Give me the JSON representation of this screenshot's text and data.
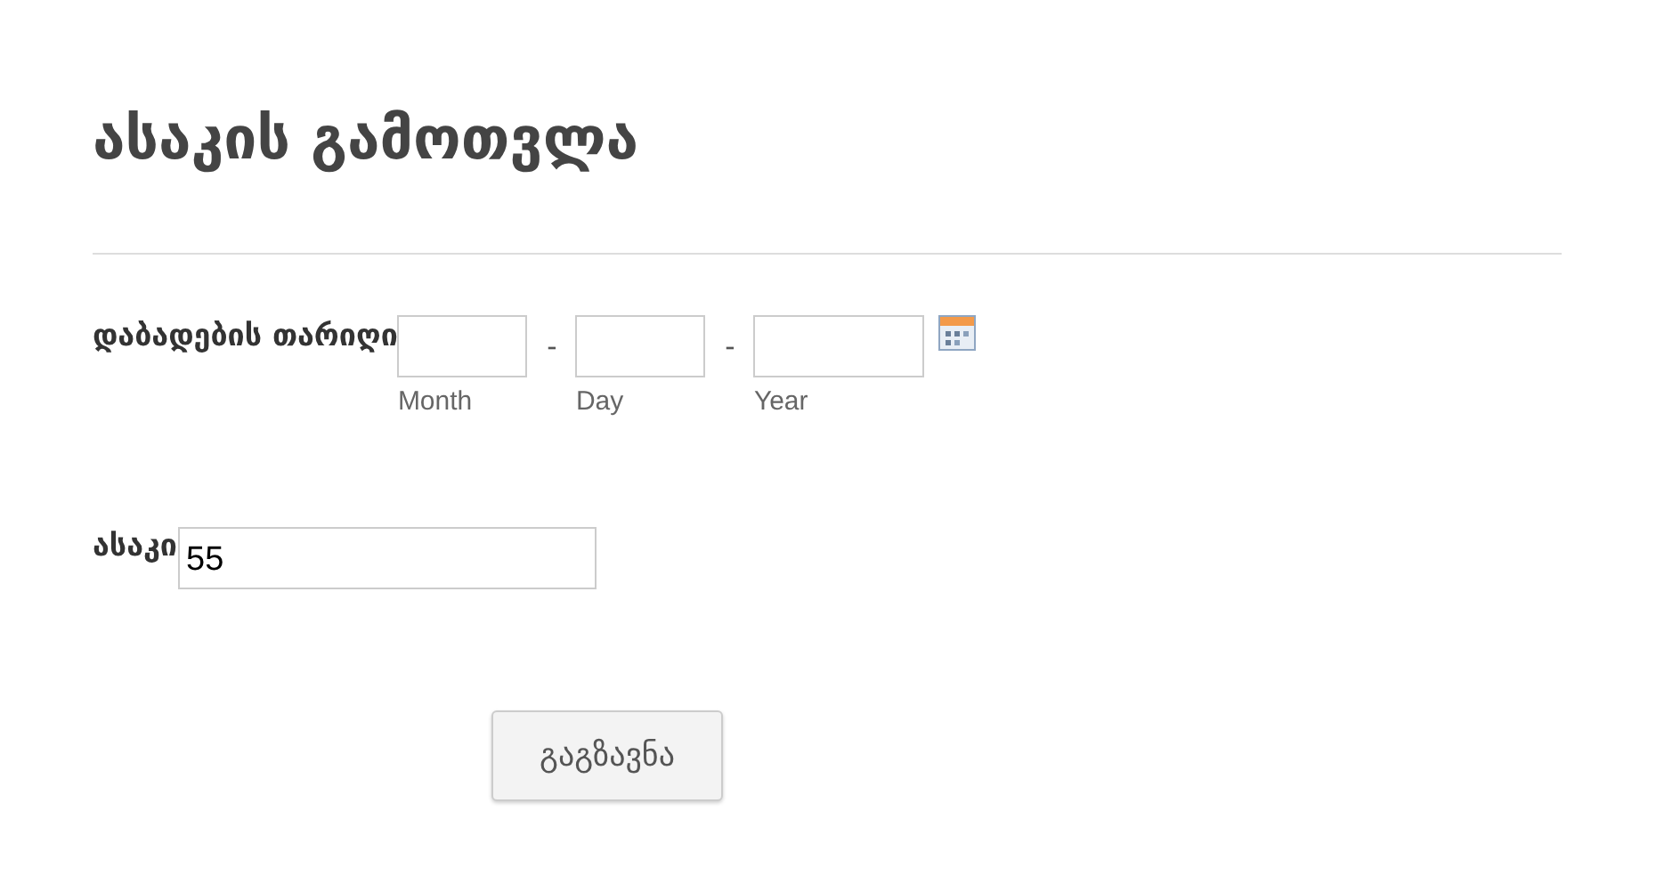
{
  "title": "ასაკის გამოთვლა",
  "birth_date": {
    "label": "დაბადების თარიღი",
    "parts": [
      {
        "sublabel": "Month"
      },
      {
        "sublabel": "Day"
      },
      {
        "sublabel": "Year"
      }
    ],
    "separators": [
      "-",
      "-"
    ]
  },
  "age": {
    "label": "ასაკი",
    "value": "55"
  },
  "submit": {
    "label": "გაგზავნა"
  }
}
